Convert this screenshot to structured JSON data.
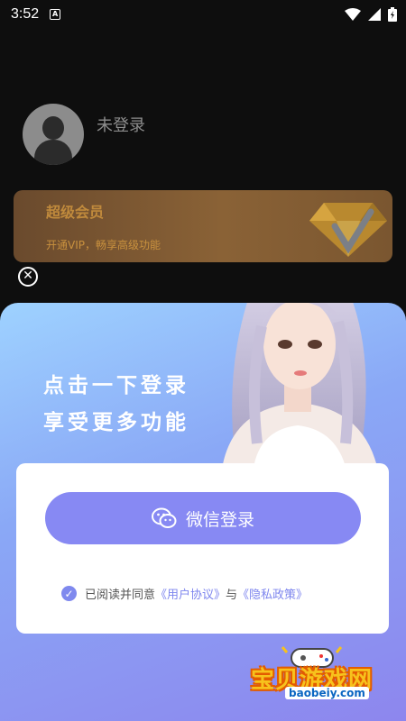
{
  "status_bar": {
    "time": "3:52",
    "notification_icon": "a-box-icon",
    "icons": [
      "wifi-icon",
      "signal-icon",
      "battery-icon"
    ]
  },
  "profile": {
    "login_status": "未登录",
    "avatar_icon": "user-icon"
  },
  "vip": {
    "title": "超级会员",
    "description": "开通VIP，畅享高级功能",
    "icon": "diamond-icon"
  },
  "close_icon": "close-icon",
  "promo": {
    "line1": "点击一下登录",
    "line2": "享受更多功能"
  },
  "login": {
    "wechat_label": "微信登录",
    "wechat_icon": "wechat-icon"
  },
  "agreement": {
    "prefix": "已阅读并同意",
    "user_agreement": "《用户协议》",
    "connector": "与",
    "privacy_policy": "《隐私政策》"
  },
  "watermark": {
    "text": "宝贝游戏网",
    "url": "baobeiy.com"
  },
  "colors": {
    "accent": "#8789f3",
    "link": "#7e86ee",
    "vip_gold": "#c08a3c"
  }
}
